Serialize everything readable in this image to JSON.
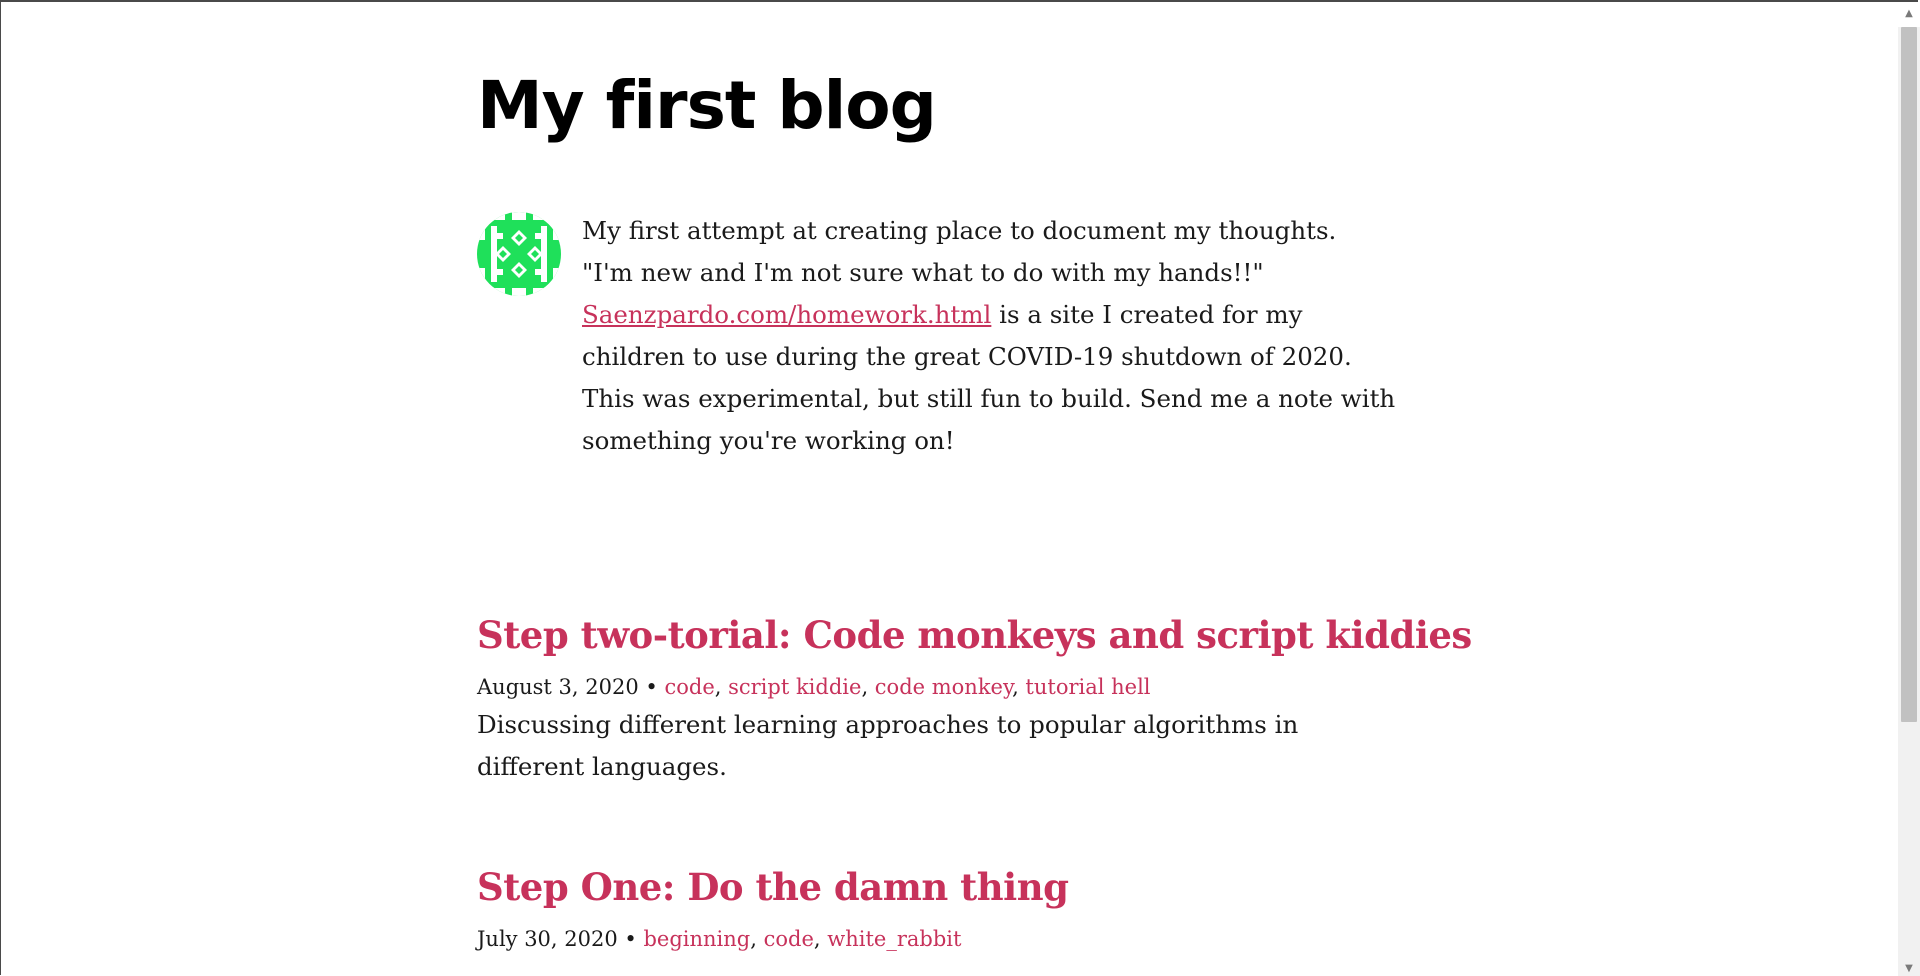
{
  "site": {
    "title": "My first blog"
  },
  "intro": {
    "line1": "My first attempt at creating place to document my thoughts.",
    "line2": "\"I'm new and I'm not sure what to do with my hands!!\"",
    "link_text": "Saenzpardo.com/homework.html",
    "after_link": " is a site I created for my children to use during the great COVID-19 shutdown of 2020. This was experimental, but still fun to build. Send me a note with something you're working on!"
  },
  "posts": [
    {
      "title": "Step two-torial: Code monkeys and script kiddies",
      "date": "August 3, 2020",
      "separator": " • ",
      "tags": [
        "code",
        "script kiddie",
        "code monkey",
        "tutorial hell"
      ],
      "description": "Discussing different learning approaches to popular algorithms in different languages."
    },
    {
      "title": "Step One: Do the damn thing",
      "date": "July 30, 2020",
      "separator": " • ",
      "tags": [
        "beginning",
        "code",
        "white_rabbit"
      ]
    }
  ],
  "colors": {
    "accent": "#c7325b",
    "avatar": "#1fe05a",
    "text": "#1a1a1a"
  },
  "icons": {
    "avatar": "identicon-icon",
    "scroll_up": "triangle-up-icon",
    "scroll_down": "triangle-down-icon"
  }
}
